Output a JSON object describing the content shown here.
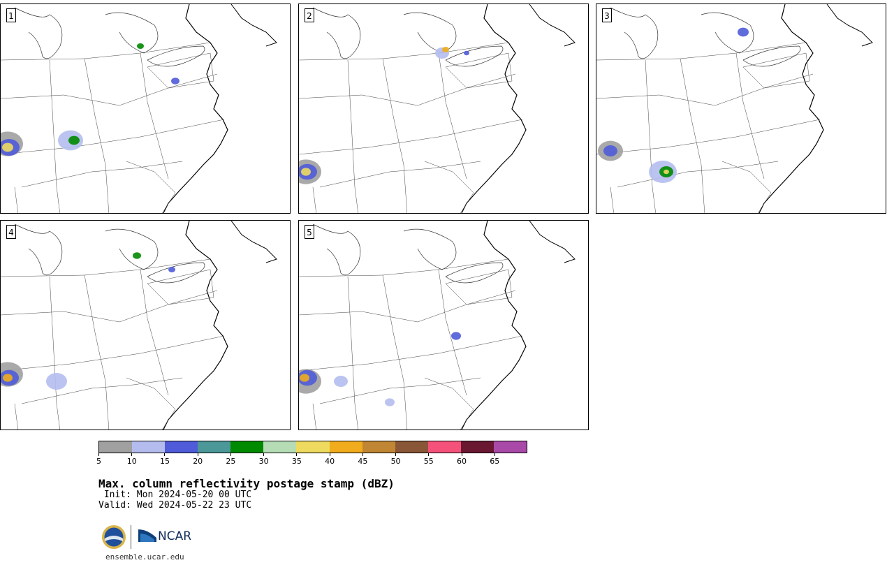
{
  "panels": [
    {
      "id": "1"
    },
    {
      "id": "2"
    },
    {
      "id": "3"
    },
    {
      "id": "4"
    },
    {
      "id": "5"
    }
  ],
  "colorbar": {
    "ticks": [
      "5",
      "10",
      "15",
      "20",
      "25",
      "30",
      "35",
      "40",
      "45",
      "50",
      "55",
      "60",
      "65"
    ],
    "colors": [
      "#a0a0a0",
      "#b4bcee",
      "#4f5bd8",
      "#4c9898",
      "#008a00",
      "#b6dcb6",
      "#eeda5e",
      "#f0ac1c",
      "#c08634",
      "#8a5638",
      "#f4527a",
      "#6a1732",
      "#aa4aa8"
    ]
  },
  "title": "Max. column reflectivity postage stamp (dBZ)",
  "init": " Init: Mon 2024-05-20 00 UTC",
  "valid": "Valid: Wed 2024-05-22 23 UTC",
  "logos": {
    "org": "NCAR"
  },
  "site": "ensemble.ucar.edu"
}
